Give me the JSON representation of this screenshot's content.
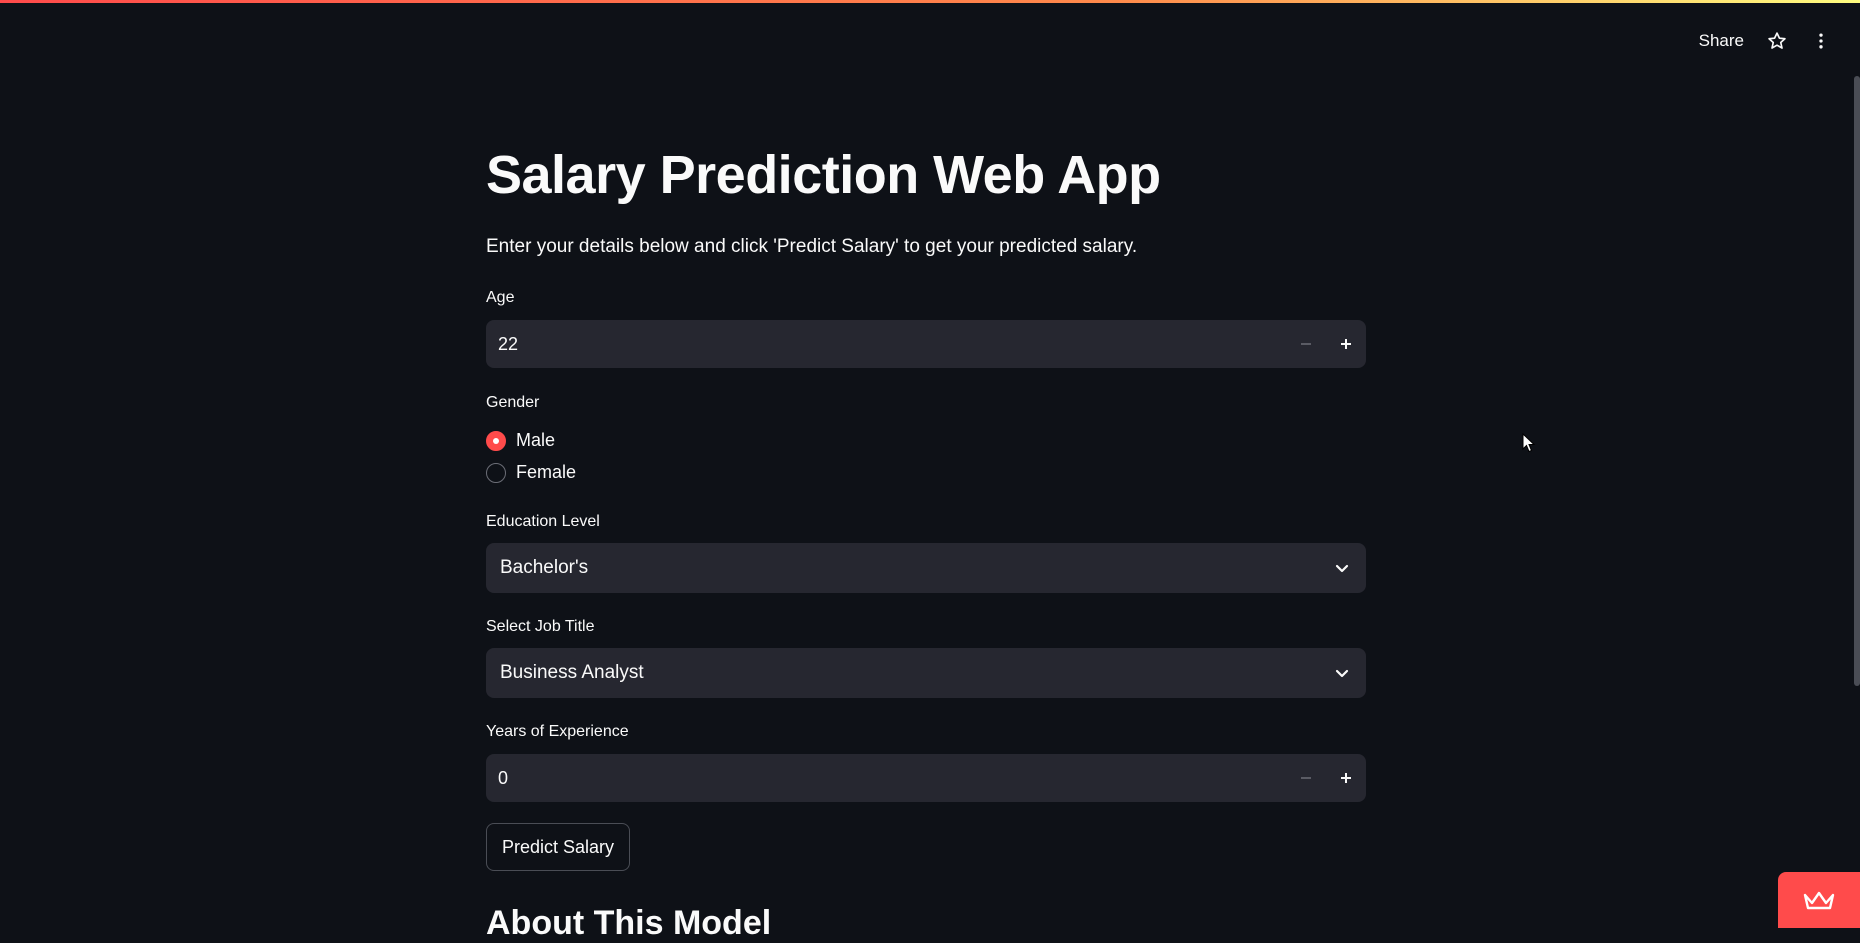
{
  "toolbar": {
    "share_label": "Share",
    "star_icon": "star-icon",
    "menu_icon": "kebab-menu-icon"
  },
  "page": {
    "title": "Salary Prediction Web App",
    "subtitle": "Enter your details below and click 'Predict Salary' to get your predicted salary."
  },
  "form": {
    "age": {
      "label": "Age",
      "value": "22"
    },
    "gender": {
      "label": "Gender",
      "options": [
        {
          "label": "Male",
          "checked": true
        },
        {
          "label": "Female",
          "checked": false
        }
      ]
    },
    "education": {
      "label": "Education Level",
      "value": "Bachelor's"
    },
    "job_title": {
      "label": "Select Job Title",
      "value": "Business Analyst"
    },
    "experience": {
      "label": "Years of Experience",
      "value": "0"
    },
    "submit_label": "Predict Salary"
  },
  "section": {
    "about_heading": "About This Model"
  },
  "colors": {
    "background": "#0e1117",
    "input_bg": "#262730",
    "accent": "#ff4b4b",
    "text": "#fafafa"
  }
}
